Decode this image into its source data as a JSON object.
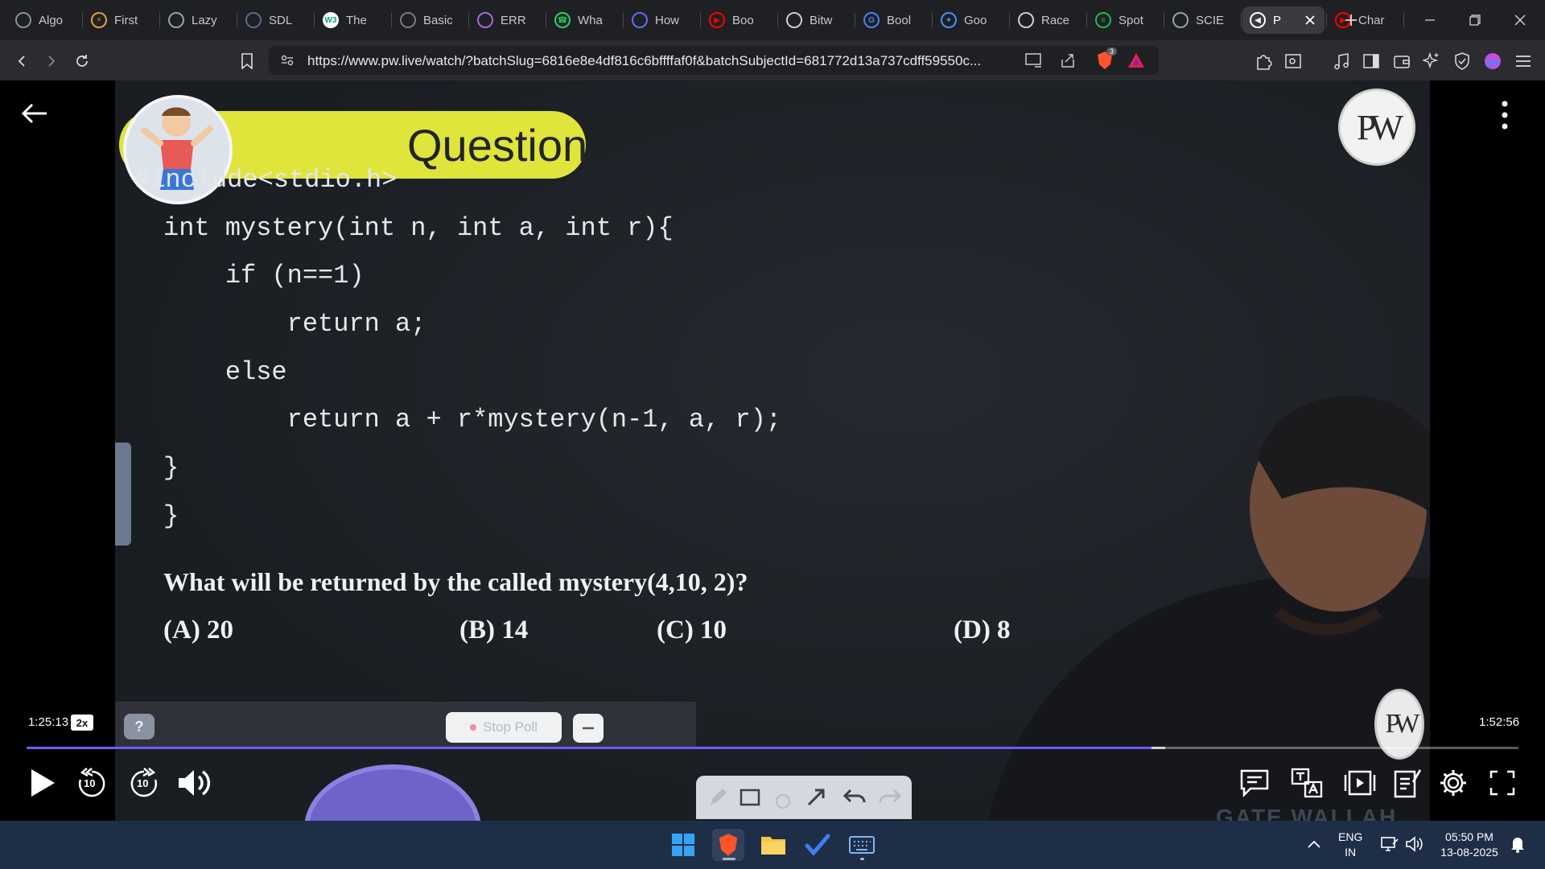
{
  "tabs": [
    {
      "label": "Algo",
      "icon": "chat-icon",
      "color": "#8a8f98"
    },
    {
      "label": "First",
      "icon": "lightning-icon",
      "color": "#e0a238"
    },
    {
      "label": "Lazy",
      "icon": "globe-icon",
      "color": "#9aa0a6"
    },
    {
      "label": "SDL",
      "icon": "site-icon",
      "color": "#5a6b8a"
    },
    {
      "label": "The",
      "icon": "w3schools-icon",
      "color": "#ffffff"
    },
    {
      "label": "Basic",
      "icon": "document-icon",
      "color": "#7a7a7a"
    },
    {
      "label": "ERR",
      "icon": "brain-icon",
      "color": "#a66ad6"
    },
    {
      "label": "Wha",
      "icon": "whatsapp-icon",
      "color": "#25d366"
    },
    {
      "label": "How",
      "icon": "bookmark-icon",
      "color": "#5b6dfa"
    },
    {
      "label": "Boo",
      "icon": "youtube-icon",
      "color": "#ff0000"
    },
    {
      "label": "Bitw",
      "icon": "site-icon",
      "color": "#cccccc"
    },
    {
      "label": "Bool",
      "icon": "google-icon",
      "color": "#4285f4"
    },
    {
      "label": "Goo",
      "icon": "gemini-icon",
      "color": "#4c8df6"
    },
    {
      "label": "Race",
      "icon": "openai-icon",
      "color": "#cfcfcf"
    },
    {
      "label": "Spot",
      "icon": "spotify-icon",
      "color": "#1db954"
    },
    {
      "label": "SCIE",
      "icon": "globe-icon",
      "color": "#9aa0a6"
    },
    {
      "label": "P",
      "icon": "speaker-icon",
      "color": "#ffffff",
      "active": true
    },
    {
      "label": "Char",
      "icon": "youtube-icon",
      "color": "#ff0000"
    }
  ],
  "browser": {
    "url": "https://www.pw.live/watch/?batchSlug=6816e8e4df816c6bffffaf0f&batchSubjectId=681772d13a737cdff59550c...",
    "shield_count": "3"
  },
  "lecture": {
    "banner_title": "Question",
    "code_lines": [
      "#include<stdio.h>",
      "int mystery(int n, int a, int r){",
      "    if (n==1)",
      "        return a;",
      "    else",
      "        return a + r*mystery(n-1, a, r);",
      "}",
      "}"
    ],
    "question": "What will be returned by the called mystery(4,10, 2)?",
    "options": [
      "(A) 20",
      "(B) 14",
      "(C) 10",
      "(D) 8"
    ],
    "logo_text": "PW",
    "gate_text": "GATE WALLAH"
  },
  "poll": {
    "help_label": "?",
    "stop_label": "Stop Poll"
  },
  "player": {
    "current_time": "1:25:13",
    "duration": "1:52:56",
    "speed": "2x",
    "progress_fraction": 0.754,
    "buffered_fraction": 0.763,
    "seek_back_label": "10",
    "seek_forward_label": "10",
    "accent": "#6b5cf6"
  },
  "taskbar": {
    "language": "ENG",
    "region": "IN",
    "time": "05:50 PM",
    "date": "13-08-2025"
  }
}
